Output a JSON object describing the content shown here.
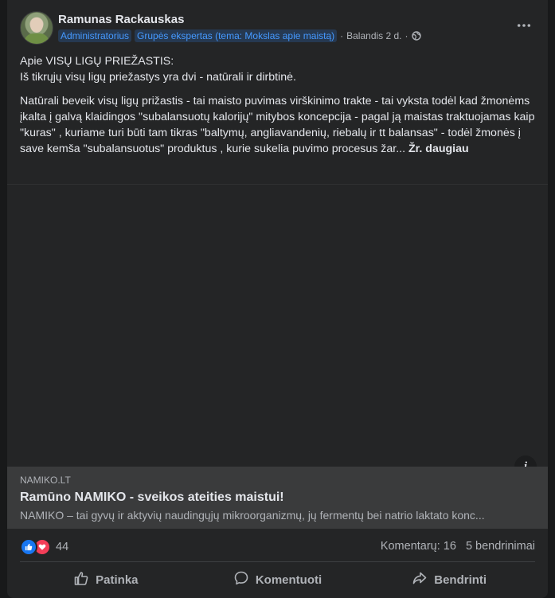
{
  "post": {
    "author": "Ramunas Rackauskas",
    "badges": [
      "Administratorius",
      "Grupės ekspertas (tema: Mokslas apie maistą)"
    ],
    "time": "Balandis 2 d.",
    "separator": "·",
    "more_icon": "more-horizontal-icon",
    "privacy_icon": "globe-icon",
    "paragraphs": [
      [
        "Apie VISŲ LIGŲ PRIEŽASTIS:",
        "Iš tikrųjų visų ligų priežastys yra dvi - natūrali ir dirbtinė."
      ],
      "Natūrali beveik visų ligų prižastis - tai maisto puvimas virškinimo trakte - tai vyksta todėl kad žmonėms įkalta į galvą klaidingos \"subalansuotų kalorijų\" mitybos koncepcija - pagal ją maistas traktuojamas kaip \"kuras\" , kuriame turi būti tam tikras \"baltymų, angliavandenių, riebalų ir tt balansas\" - todėl žmonės į save kemša \"subalansuotus\" produktus , kurie sukelia puvimo procesus žar..."
    ],
    "see_more": "Žr. daugiau"
  },
  "link": {
    "domain": "NAMIKO.LT",
    "title": "Ramūno NAMIKO - sveikos ateities maistui!",
    "description": "NAMIKO – tai gyvų ir aktyvių naudingųjų mikroorganizmų, jų fermentų bei natrio laktato konc...",
    "info_label": "i"
  },
  "stats": {
    "reaction_count": "44",
    "comments": "Komentarų: 16",
    "shares": "5 bendrinimai",
    "reaction_icons": [
      "like-icon",
      "love-icon"
    ]
  },
  "actions": {
    "like": "Patinka",
    "comment": "Komentuoti",
    "share": "Bendrinti"
  },
  "colors": {
    "background": "#18191a",
    "card": "#242526",
    "badge_text": "#4599ff",
    "like": "#1877f2",
    "love": "#f33e58"
  }
}
